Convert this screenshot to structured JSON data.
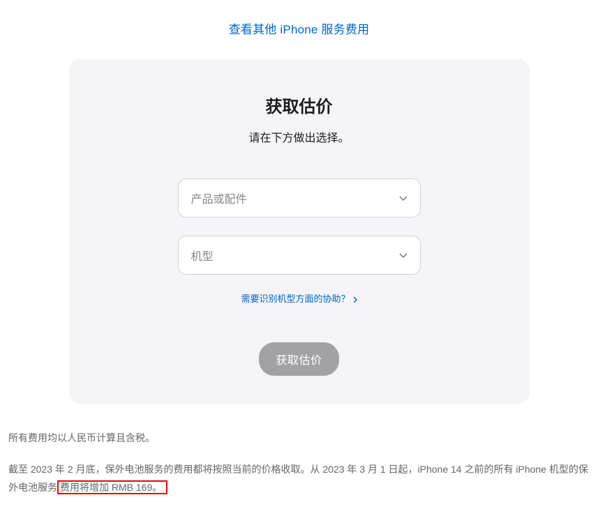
{
  "topLink": {
    "label": "查看其他 iPhone 服务费用"
  },
  "card": {
    "title": "获取估价",
    "subtitle": "请在下方做出选择。",
    "selectProduct": {
      "placeholder": "产品或配件"
    },
    "selectModel": {
      "placeholder": "机型"
    },
    "helpLink": {
      "label": "需要识别机型方面的协助？"
    },
    "submit": {
      "label": "获取估价"
    }
  },
  "footer": {
    "line1": "所有费用均以人民币计算且含税。",
    "line2_a": "截至 2023 年 2 月底，保外电池服务的费用都将按照当前的价格收取。从 2023 年 3 月 1 日起，iPhone 14 之前的所有 iPhone 机型的保外电池服务",
    "line2_b": "费用将增加 RMB 169。"
  }
}
